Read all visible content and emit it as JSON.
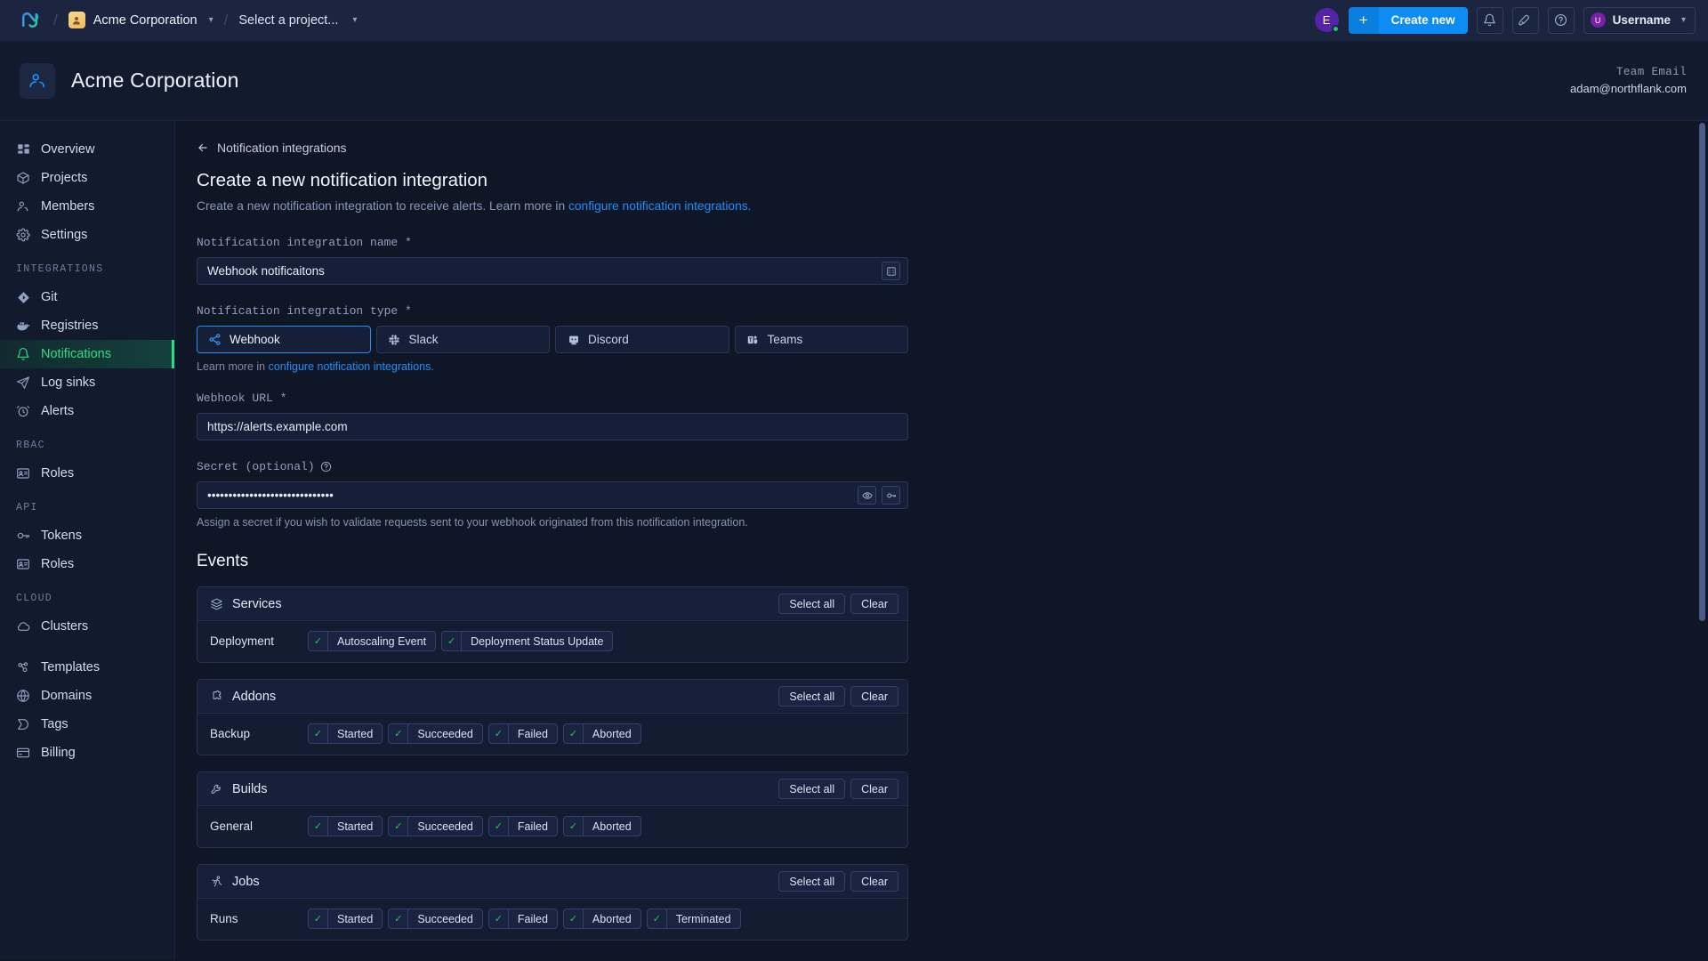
{
  "topbar": {
    "logo_icon": "northflank-logo-icon",
    "org_name": "Acme Corporation",
    "org_avatar_icon": "org-avatar-icon",
    "project_selector": "Select a project...",
    "account_initial": "E",
    "create_label": "Create new",
    "plus_label": "+",
    "icons": [
      "bell-icon",
      "rocket-icon",
      "help-circle-icon"
    ],
    "user_initial": "U",
    "user_name": "Username",
    "accent_blue": "#0d8cf5",
    "status_green": "#29c26a"
  },
  "page_header": {
    "icon": "team-icon",
    "title": "Acme Corporation",
    "meta_label": "Team Email",
    "meta_value": "adam@northflank.com"
  },
  "sidebar": {
    "items": [
      {
        "label": "Overview",
        "icon": "grid-icon",
        "active": false
      },
      {
        "label": "Projects",
        "icon": "box-icon",
        "active": false
      },
      {
        "label": "Members",
        "icon": "members-icon",
        "active": false
      },
      {
        "label": "Settings",
        "icon": "gear-icon",
        "active": false
      }
    ],
    "sections": [
      {
        "title": "INTEGRATIONS",
        "items": [
          {
            "label": "Git",
            "icon": "git-icon",
            "active": false
          },
          {
            "label": "Registries",
            "icon": "docker-icon",
            "active": false
          },
          {
            "label": "Notifications",
            "icon": "bell-icon",
            "active": true
          },
          {
            "label": "Log sinks",
            "icon": "send-icon",
            "active": false
          },
          {
            "label": "Alerts",
            "icon": "alarm-icon",
            "active": false
          }
        ]
      },
      {
        "title": "RBAC",
        "items": [
          {
            "label": "Roles",
            "icon": "id-card-icon",
            "active": false
          }
        ]
      },
      {
        "title": "API",
        "items": [
          {
            "label": "Tokens",
            "icon": "key-icon",
            "active": false
          },
          {
            "label": "Roles",
            "icon": "id-card-icon",
            "active": false
          }
        ]
      },
      {
        "title": "CLOUD",
        "items": [
          {
            "label": "Clusters",
            "icon": "cloud-icon",
            "active": false
          }
        ]
      },
      {
        "title": "",
        "items": [
          {
            "label": "Templates",
            "icon": "template-icon",
            "active": false
          },
          {
            "label": "Domains",
            "icon": "globe-icon",
            "active": false
          },
          {
            "label": "Tags",
            "icon": "tag-icon",
            "active": false
          },
          {
            "label": "Billing",
            "icon": "credit-card-icon",
            "active": false
          }
        ]
      }
    ],
    "active_color": "#2fdd84"
  },
  "main": {
    "back_link": "Notification integrations",
    "title": "Create a new notification integration",
    "subtitle_text": "Create a new notification integration to receive alerts. Learn more in ",
    "subtitle_link": "configure notification integrations.",
    "fields": {
      "name_label": "Notification integration name *",
      "name_value": "Webhook notificaitons",
      "name_placeholder": "Notification integration name",
      "name_trailing_icon": "template-variable-icon",
      "type_label": "Notification integration type *",
      "type_hint_text": "Learn more in ",
      "type_hint_link": "configure notification integrations.",
      "url_label": "Webhook URL *",
      "url_value": "https://alerts.example.com",
      "url_placeholder": "https://",
      "secret_label": "Secret (optional)",
      "secret_help_icon": "help-circle-icon",
      "secret_value": "••••••••••••••••••••••••••••••",
      "secret_reveal_icon": "eye-icon",
      "secret_generate_icon": "key-icon",
      "secret_helper": "Assign a secret if you wish to validate requests sent to your webhook originated from this notification integration."
    },
    "types": [
      {
        "label": "Webhook",
        "icon": "webhook-icon",
        "selected": true
      },
      {
        "label": "Slack",
        "icon": "slack-icon",
        "selected": false
      },
      {
        "label": "Discord",
        "icon": "discord-icon",
        "selected": false
      },
      {
        "label": "Teams",
        "icon": "teams-icon",
        "selected": false
      }
    ],
    "events_title": "Events",
    "select_all_label": "Select all",
    "clear_label": "Clear",
    "event_cards": [
      {
        "title": "Services",
        "icon": "layers-icon",
        "rows": [
          {
            "label": "Deployment",
            "chips": [
              {
                "label": "Autoscaling Event",
                "checked": true
              },
              {
                "label": "Deployment Status Update",
                "checked": true
              }
            ]
          }
        ]
      },
      {
        "title": "Addons",
        "icon": "addon-icon",
        "rows": [
          {
            "label": "Backup",
            "chips": [
              {
                "label": "Started",
                "checked": true
              },
              {
                "label": "Succeeded",
                "checked": true
              },
              {
                "label": "Failed",
                "checked": true
              },
              {
                "label": "Aborted",
                "checked": true
              }
            ]
          }
        ]
      },
      {
        "title": "Builds",
        "icon": "build-icon",
        "rows": [
          {
            "label": "General",
            "chips": [
              {
                "label": "Started",
                "checked": true
              },
              {
                "label": "Succeeded",
                "checked": true
              },
              {
                "label": "Failed",
                "checked": true
              },
              {
                "label": "Aborted",
                "checked": true
              }
            ]
          }
        ]
      },
      {
        "title": "Jobs",
        "icon": "runner-icon",
        "rows": [
          {
            "label": "Runs",
            "chips": [
              {
                "label": "Started",
                "checked": true
              },
              {
                "label": "Succeeded",
                "checked": true
              },
              {
                "label": "Failed",
                "checked": true
              },
              {
                "label": "Aborted",
                "checked": true
              },
              {
                "label": "Terminated",
                "checked": true
              }
            ]
          }
        ]
      }
    ]
  }
}
